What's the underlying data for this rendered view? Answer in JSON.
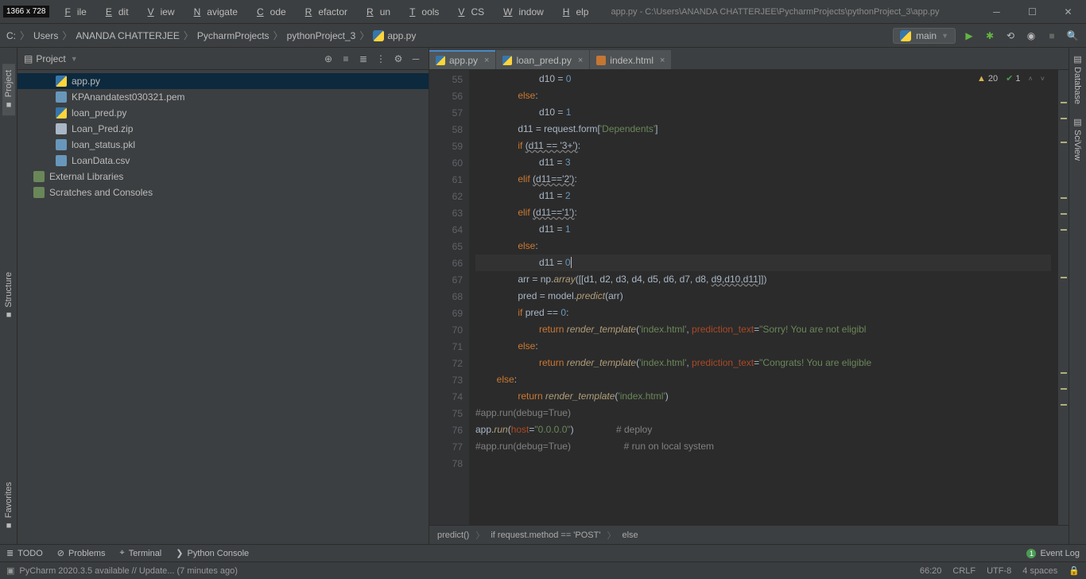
{
  "window": {
    "title": "app.py - C:\\Users\\ANANDA CHATTERJEE\\PycharmProjects\\pythonProject_3\\app.py",
    "dim_badge": "1366 x 728"
  },
  "menu": [
    "File",
    "Edit",
    "View",
    "Navigate",
    "Code",
    "Refactor",
    "Run",
    "Tools",
    "VCS",
    "Window",
    "Help"
  ],
  "breadcrumb": [
    "C:",
    "Users",
    "ANANDA CHATTERJEE",
    "PycharmProjects",
    "pythonProject_3",
    "app.py"
  ],
  "run_config": "main",
  "sidebar": {
    "title": "Project",
    "items": [
      {
        "label": "app.py",
        "icon": "ic-py",
        "selected": true
      },
      {
        "label": "KPAnandatest030321.pem",
        "icon": "ic-file"
      },
      {
        "label": "loan_pred.py",
        "icon": "ic-py"
      },
      {
        "label": "Loan_Pred.zip",
        "icon": "ic-zip"
      },
      {
        "label": "loan_status.pkl",
        "icon": "ic-file"
      },
      {
        "label": "LoanData.csv",
        "icon": "ic-file"
      }
    ],
    "extras": [
      {
        "label": "External Libraries",
        "icon": "ic-lib"
      },
      {
        "label": "Scratches and Consoles",
        "icon": "ic-file"
      }
    ]
  },
  "tabs": [
    {
      "label": "app.py",
      "active": true,
      "icon": "ic-py"
    },
    {
      "label": "loan_pred.py",
      "active": false,
      "icon": "ic-py"
    },
    {
      "label": "index.html",
      "active": false,
      "icon": "ic-file"
    }
  ],
  "problems": {
    "warnings": "20",
    "checks": "1"
  },
  "line_start": 55,
  "line_end": 78,
  "code": [
    {
      "n": 55,
      "indent": 24,
      "tokens": [
        [
          "",
          "d10 "
        ],
        [
          "eq",
          "= "
        ],
        [
          "num",
          "0"
        ]
      ]
    },
    {
      "n": 56,
      "indent": 16,
      "tokens": [
        [
          "kw",
          "else"
        ],
        [
          "",
          ":"
        ]
      ]
    },
    {
      "n": 57,
      "indent": 24,
      "tokens": [
        [
          "",
          "d10 "
        ],
        [
          "eq",
          "= "
        ],
        [
          "num",
          "1"
        ]
      ]
    },
    {
      "n": 58,
      "indent": 16,
      "tokens": [
        [
          "",
          "d11 "
        ],
        [
          "eq",
          "= "
        ],
        [
          "",
          "request.form["
        ],
        [
          "str",
          "'Dependents'"
        ],
        [
          "",
          "]"
        ]
      ]
    },
    {
      "n": 59,
      "indent": 16,
      "tokens": [
        [
          "kw",
          "if "
        ],
        [
          "warn",
          "(d11 == '3+')"
        ],
        [
          "",
          ":"
        ]
      ]
    },
    {
      "n": 60,
      "indent": 24,
      "tokens": [
        [
          "",
          "d11 "
        ],
        [
          "eq",
          "= "
        ],
        [
          "num",
          "3"
        ]
      ]
    },
    {
      "n": 61,
      "indent": 16,
      "tokens": [
        [
          "kw",
          "elif "
        ],
        [
          "warn",
          "(d11=='2')"
        ],
        [
          "",
          ":"
        ]
      ]
    },
    {
      "n": 62,
      "indent": 24,
      "tokens": [
        [
          "",
          "d11 "
        ],
        [
          "eq",
          "= "
        ],
        [
          "num",
          "2"
        ]
      ]
    },
    {
      "n": 63,
      "indent": 16,
      "tokens": [
        [
          "kw",
          "elif "
        ],
        [
          "warn",
          "(d11=='1')"
        ],
        [
          "",
          ":"
        ]
      ]
    },
    {
      "n": 64,
      "indent": 24,
      "tokens": [
        [
          "",
          "d11 "
        ],
        [
          "eq",
          "= "
        ],
        [
          "num",
          "1"
        ]
      ]
    },
    {
      "n": 65,
      "indent": 16,
      "tokens": [
        [
          "kw",
          "else"
        ],
        [
          "",
          ":"
        ]
      ]
    },
    {
      "n": 66,
      "indent": 24,
      "hl": true,
      "caret": true,
      "tokens": [
        [
          "",
          "d11 "
        ],
        [
          "eq",
          "= "
        ],
        [
          "num",
          "0"
        ]
      ]
    },
    {
      "n": 67,
      "indent": 16,
      "tokens": [
        [
          "",
          "arr "
        ],
        [
          "eq",
          "= "
        ],
        [
          "",
          "np."
        ],
        [
          "fn",
          "array"
        ],
        [
          "",
          "([[d1"
        ],
        [
          "op",
          ", "
        ],
        [
          "",
          "d2"
        ],
        [
          "op",
          ", "
        ],
        [
          "",
          "d3"
        ],
        [
          "op",
          ", "
        ],
        [
          "",
          "d4"
        ],
        [
          "op",
          ", "
        ],
        [
          "",
          "d5"
        ],
        [
          "op",
          ", "
        ],
        [
          "",
          "d6"
        ],
        [
          "op",
          ", "
        ],
        [
          "",
          "d7"
        ],
        [
          "op",
          ", "
        ],
        [
          "",
          "d8"
        ],
        [
          "op",
          ", "
        ],
        [
          "warn",
          "d9,d10,d11"
        ],
        [
          "",
          "]])"
        ]
      ]
    },
    {
      "n": 68,
      "indent": 16,
      "tokens": [
        [
          "",
          "pred "
        ],
        [
          "eq",
          "= "
        ],
        [
          "",
          "model."
        ],
        [
          "fn",
          "predict"
        ],
        [
          "",
          "(arr)"
        ]
      ]
    },
    {
      "n": 69,
      "indent": 16,
      "tokens": [
        [
          "kw",
          "if "
        ],
        [
          "",
          "pred "
        ],
        [
          "eq",
          "== "
        ],
        [
          "num",
          "0"
        ],
        [
          "",
          ":"
        ]
      ]
    },
    {
      "n": 70,
      "indent": 24,
      "tokens": [
        [
          "kw",
          "return "
        ],
        [
          "fn",
          "render_template"
        ],
        [
          "",
          "("
        ],
        [
          "str",
          "'index.html'"
        ],
        [
          "op",
          ", "
        ],
        [
          "param",
          "prediction_text"
        ],
        [
          "eq",
          "="
        ],
        [
          "str",
          "\"Sorry! You are not eligibl"
        ]
      ]
    },
    {
      "n": 71,
      "indent": 16,
      "tokens": [
        [
          "kw",
          "else"
        ],
        [
          "",
          ":"
        ]
      ]
    },
    {
      "n": 72,
      "indent": 24,
      "tokens": [
        [
          "kw",
          "return "
        ],
        [
          "fn",
          "render_template"
        ],
        [
          "",
          "("
        ],
        [
          "str",
          "'index.html'"
        ],
        [
          "op",
          ", "
        ],
        [
          "param",
          "prediction_text"
        ],
        [
          "eq",
          "="
        ],
        [
          "str",
          "\"Congrats! You are eligible"
        ]
      ]
    },
    {
      "n": 73,
      "indent": 8,
      "tokens": [
        [
          "kw",
          "else"
        ],
        [
          "",
          ":"
        ]
      ]
    },
    {
      "n": 74,
      "indent": 16,
      "tokens": [
        [
          "kw",
          "return "
        ],
        [
          "fn",
          "render_template"
        ],
        [
          "",
          "("
        ],
        [
          "str",
          "'index.html'"
        ],
        [
          "",
          ")"
        ]
      ]
    },
    {
      "n": 75,
      "indent": 0,
      "tokens": [
        [
          "",
          ""
        ]
      ]
    },
    {
      "n": 76,
      "indent": 0,
      "tokens": [
        [
          "cm",
          "#app.run(debug=True)"
        ]
      ]
    },
    {
      "n": 77,
      "indent": 0,
      "tokens": [
        [
          "",
          "app."
        ],
        [
          "fn",
          "run"
        ],
        [
          "",
          "("
        ],
        [
          "param",
          "host"
        ],
        [
          "eq",
          "="
        ],
        [
          "str",
          "\"0.0.0.0\""
        ],
        [
          "",
          ")"
        ],
        [
          "",
          "                "
        ],
        [
          "cm",
          "# deploy"
        ]
      ]
    },
    {
      "n": 78,
      "indent": 0,
      "tokens": [
        [
          "cm",
          "#app.run(debug=True)                    # run on local system"
        ]
      ]
    }
  ],
  "breadcrumb2": [
    "predict()",
    "if request.method == 'POST'",
    "else"
  ],
  "bottom_tools": [
    "TODO",
    "Problems",
    "Terminal",
    "Python Console"
  ],
  "event_log": {
    "count": "1",
    "label": "Event Log"
  },
  "status": {
    "update": "PyCharm 2020.3.5 available // Update... (7 minutes ago)",
    "pos": "66:20",
    "eol": "CRLF",
    "enc": "UTF-8",
    "indent": "4 spaces"
  },
  "left_tabs": [
    "Project",
    "Structure",
    "Favorites"
  ],
  "right_tabs": [
    "Database",
    "SciView"
  ]
}
